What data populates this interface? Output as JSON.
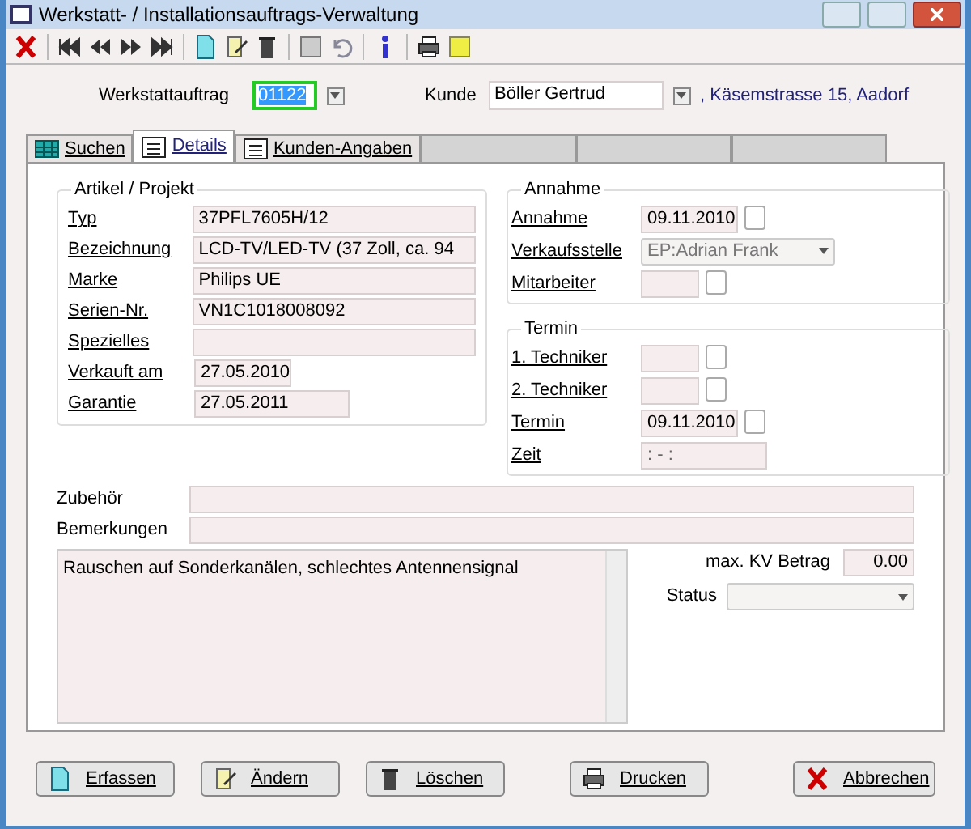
{
  "window": {
    "title": "Werkstatt- / Installationsauftrags-Verwaltung"
  },
  "header": {
    "order_label": "Werkstattauftrag",
    "order_value": "01122",
    "customer_label": "Kunde",
    "customer_value": "Böller Gertrud",
    "customer_address": ", Käsemstrasse 15, Aadorf"
  },
  "tabs": [
    {
      "label": "Suchen",
      "selected": false,
      "kind": "grid"
    },
    {
      "label": "Details",
      "selected": true,
      "kind": "list"
    },
    {
      "label": "Kunden-Angaben",
      "selected": false,
      "kind": "list"
    }
  ],
  "article": {
    "title": "Artikel / Projekt",
    "fields": [
      {
        "label": "Typ",
        "value": "37PFL7605H/12",
        "kind": "text"
      },
      {
        "label": "Bezeichnung",
        "value": "LCD-TV/LED-TV (37 Zoll, ca. 94",
        "kind": "text"
      },
      {
        "label": "Marke",
        "value": "Philips UE",
        "kind": "text"
      },
      {
        "label": "Serien-Nr.",
        "value": "VN1C1018008092",
        "kind": "text"
      },
      {
        "label": "Spezielles",
        "kind": "text"
      },
      {
        "label": "Verkauft am",
        "value": "27.05.2010",
        "kind": "date"
      },
      {
        "label": "Garantie",
        "value": "27.05.2011",
        "kind": "date_wide"
      }
    ]
  },
  "intake": {
    "title": "Annahme",
    "fields": [
      {
        "label": "Annahme",
        "value": "09.11.2010",
        "kind": "date"
      },
      {
        "label": "Verkaufsstelle",
        "value": "EP:Adrian Frank",
        "kind": "dropdown",
        "disabled": true
      },
      {
        "label": "Mitarbeiter",
        "kind": "picker"
      }
    ]
  },
  "schedule": {
    "title": "Termin",
    "fields": [
      {
        "label": "1. Techniker",
        "kind": "picker"
      },
      {
        "label": "2. Techniker",
        "kind": "picker"
      },
      {
        "label": "Termin",
        "value": "09.11.2010",
        "kind": "date"
      },
      {
        "label": "Zeit",
        "value": " :  - :",
        "kind": "time"
      }
    ]
  },
  "extras": [
    {
      "label": "Zubehör"
    },
    {
      "label": "Bemerkungen"
    }
  ],
  "description": "Rauschen auf Sonderkanälen, schlechtes Antennensignal",
  "kv": {
    "label": "max. KV Betrag",
    "value": "0.00"
  },
  "status": {
    "label": "Status"
  },
  "buttons": [
    {
      "label": "Erfassen",
      "kind": "new"
    },
    {
      "label": "Ändern",
      "kind": "edit"
    },
    {
      "label": "Löschen",
      "kind": "delete"
    },
    {
      "label": "Drucken",
      "kind": "print"
    },
    {
      "label": "Abbrechen",
      "kind": "cancel"
    }
  ]
}
